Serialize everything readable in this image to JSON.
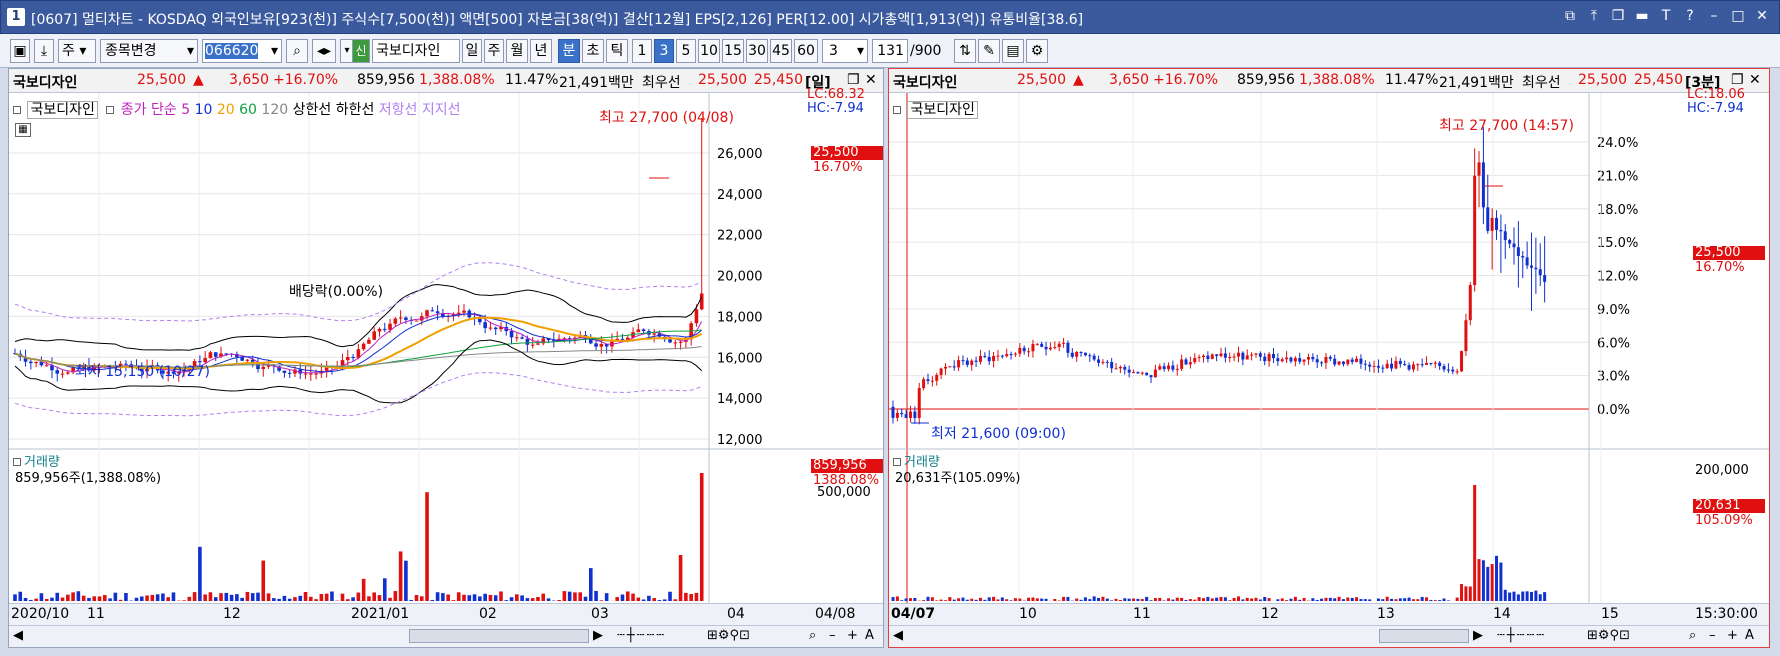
{
  "window": {
    "badge": "1",
    "title": "[0607] 멀티차트 - KOSDAQ 외국인보유[923(천)] 주식수[7,500(천)] 액면[500] 자본금[38(억)] 결산[12월] EPS[2,126] PER[12.00] 시가총액[1,913(억)] 유통비율[38.6]",
    "controls": [
      "⧉",
      "⤒",
      "❐",
      "▬",
      "T",
      "?",
      "–",
      "□",
      "✕"
    ]
  },
  "toolbar": {
    "code_kind": "주",
    "change_label": "종목변경",
    "code": "066620",
    "new_label": "신",
    "stock_name": "국보디자인",
    "periods": [
      "일",
      "주",
      "월",
      "년",
      "분",
      "초",
      "틱"
    ],
    "selected_period": "분",
    "minutes": [
      "1",
      "3",
      "5",
      "10",
      "15",
      "30",
      "45",
      "60"
    ],
    "selected_minute": "3",
    "interval_value": "3",
    "count": "131",
    "count_total": "/900"
  },
  "left": {
    "info": {
      "name": "국보디자인",
      "price": "25,500",
      "arrow": "▲",
      "change": "3,650",
      "pct": "+16.70%",
      "volume": "859,956",
      "vol_pct": "1,388.08%",
      "turnover": "11.47%",
      "amount": "21,491백만",
      "best_label": "최우선",
      "ask": "25,500",
      "bid": "25,450",
      "period_tag": "[일]"
    },
    "legend": {
      "name": "국보디자인",
      "ma_label": "종가 단순",
      "ma": [
        "5",
        "10",
        "20",
        "60",
        "120"
      ],
      "upper": "상한선",
      "lower": "하한선",
      "resist": "저항선",
      "support": "지지선"
    },
    "lc": "LC:68.32",
    "hc": "HC:-7.94",
    "high_label": "최고 27,700 (04/08)",
    "low_label": "최저 15,150 (10/27)",
    "dividend_label": "배당락(0.00%)",
    "price_tag": "25,500",
    "pct_tag": "16.70%",
    "yticks": [
      "26,000",
      "24,000",
      "22,000",
      "20,000",
      "18,000",
      "16,000",
      "14,000",
      "12,000"
    ],
    "volume": {
      "title": "거래량",
      "value_label": "859,956주(1,388.08%)",
      "tag": "859,956",
      "tag_pct": "1388.08%",
      "ytick": "500,000"
    },
    "xlabels": [
      "2020/10",
      "11",
      "12",
      "2021/01",
      "02",
      "03",
      "04",
      "04/08"
    ]
  },
  "right": {
    "info": {
      "name": "국보디자인",
      "price": "25,500",
      "arrow": "▲",
      "change": "3,650",
      "pct": "+16.70%",
      "volume": "859,956",
      "vol_pct": "1,388.08%",
      "turnover": "11.47%",
      "amount": "21,491백만",
      "best_label": "최우선",
      "ask": "25,500",
      "bid": "25,450",
      "period_tag": "[3분]"
    },
    "legend": {
      "name": "국보디자인"
    },
    "lc": "LC:18.06",
    "hc": "HC:-7.94",
    "high_label": "최고 27,700 (14:57)",
    "low_label": "최저 21,600 (09:00)",
    "price_tag": "25,500",
    "pct_tag": "16.70%",
    "yticks": [
      "24.0%",
      "21.0%",
      "18.0%",
      "15.0%",
      "12.0%",
      "9.0%",
      "6.0%",
      "3.0%",
      "0.0%"
    ],
    "volume": {
      "title": "거래량",
      "value_label": "20,631주(105.09%)",
      "tag": "20,631",
      "tag_pct": "105.09%",
      "ytick": "200,000"
    },
    "xlabels": [
      "04/07",
      "10",
      "11",
      "12",
      "13",
      "14",
      "15",
      "15:30:00"
    ]
  },
  "colors": {
    "up": "#e01010",
    "down": "#1030d0",
    "ma5": "#c020c0",
    "ma10": "#1030d0",
    "ma20": "#f0a000",
    "ma60": "#10a040",
    "ma120": "#888888",
    "band": "#000000",
    "envelope": "#b080f0"
  }
}
